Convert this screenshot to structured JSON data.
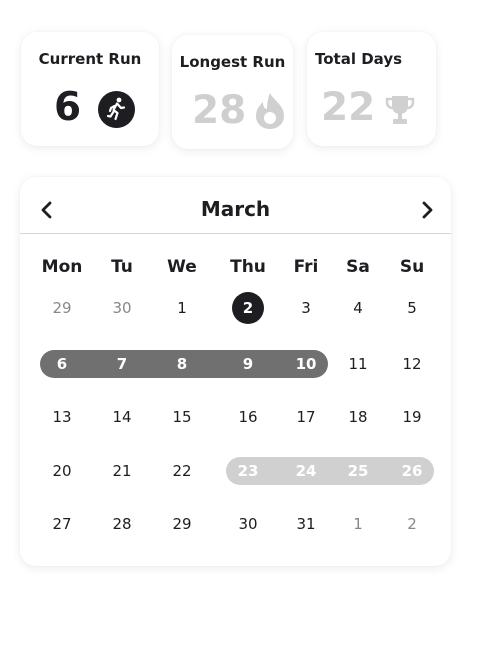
{
  "stats": {
    "current_run": {
      "title": "Current Run",
      "value": "6",
      "icon": "runner-icon"
    },
    "longest_run": {
      "title": "Longest Run",
      "value": "28",
      "icon": "flame-icon"
    },
    "total_days": {
      "title": "Total Days",
      "value": "22",
      "icon": "trophy-icon"
    }
  },
  "calendar": {
    "month": "March",
    "prev_icon": "chevron-left-icon",
    "next_icon": "chevron-right-icon",
    "weekdays": [
      "Mon",
      "Tu",
      "We",
      "Thu",
      "Fri",
      "Sa",
      "Su"
    ],
    "weeks": [
      [
        {
          "d": "29",
          "muted": true
        },
        {
          "d": "30",
          "muted": true
        },
        {
          "d": "1"
        },
        {
          "d": "2",
          "selected": true
        },
        {
          "d": "3"
        },
        {
          "d": "4"
        },
        {
          "d": "5"
        }
      ],
      [
        {
          "d": "6",
          "streak": "dark"
        },
        {
          "d": "7",
          "streak": "dark"
        },
        {
          "d": "8",
          "streak": "dark"
        },
        {
          "d": "9",
          "streak": "dark"
        },
        {
          "d": "10",
          "streak": "dark"
        },
        {
          "d": "11"
        },
        {
          "d": "12"
        }
      ],
      [
        {
          "d": "13"
        },
        {
          "d": "14"
        },
        {
          "d": "15"
        },
        {
          "d": "16"
        },
        {
          "d": "17"
        },
        {
          "d": "18"
        },
        {
          "d": "19"
        }
      ],
      [
        {
          "d": "20"
        },
        {
          "d": "21"
        },
        {
          "d": "22"
        },
        {
          "d": "23",
          "streak": "light"
        },
        {
          "d": "24",
          "streak": "light"
        },
        {
          "d": "25",
          "streak": "light"
        },
        {
          "d": "26",
          "streak": "light"
        }
      ],
      [
        {
          "d": "27"
        },
        {
          "d": "28"
        },
        {
          "d": "29"
        },
        {
          "d": "30"
        },
        {
          "d": "31"
        },
        {
          "d": "1",
          "muted": true
        },
        {
          "d": "2",
          "muted": true
        }
      ]
    ]
  },
  "colors": {
    "accent_dark": "#1d1d22",
    "streak_dark": "#707070",
    "streak_light": "#d0d0d0",
    "muted_value": "#cfcfcf"
  }
}
